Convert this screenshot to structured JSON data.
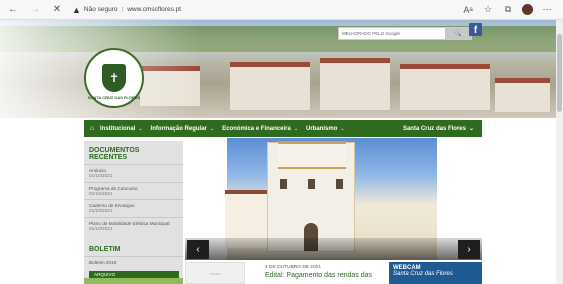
{
  "browser": {
    "back": "←",
    "forward": "→",
    "close": "✕",
    "security_warning_icon": "▲",
    "not_secure": "Não seguro",
    "url": "www.cmscflores.pt"
  },
  "header": {
    "search_placeholder": "MELHORADO PELO Google",
    "search_button": "🔍",
    "facebook": "f",
    "logo_text": "SANTA CRUZ DAS FLORES"
  },
  "nav": {
    "home": "⌂",
    "items": [
      {
        "label": "Institucional"
      },
      {
        "label": "Informação Regular"
      },
      {
        "label": "Económica e Financeira"
      },
      {
        "label": "Urbanismo"
      }
    ],
    "right": "Santa Cruz das Flores"
  },
  "sidebar": {
    "docs_title": "DOCUMENTOS RECENTES",
    "docs": [
      {
        "title": "Anúncio",
        "date": "01/10/2021"
      },
      {
        "title": "Programa de Concurso",
        "date": "01/10/2021"
      },
      {
        "title": "Caderno de Encargos",
        "date": "01/10/2021"
      },
      {
        "title": "Plano de Mobilidade Elétrica Municipal",
        "date": "01/10/2021"
      }
    ],
    "boletim_title": "BOLETIM",
    "boletim_item": "Boletim 2019",
    "arquivo": "ARQUIVO"
  },
  "slider": {
    "prev": "‹",
    "next": "›"
  },
  "news": {
    "date": "4 DE OUTUBRO DE 2021",
    "title": "Edital: Pagamento das rendas das"
  },
  "webcam": {
    "label": "WEBCAM",
    "place": "Santa Cruz das Flores"
  },
  "colors": {
    "green": "#2e6b1d",
    "facebook": "#3b5998",
    "webcam_blue": "#1e5b95"
  }
}
